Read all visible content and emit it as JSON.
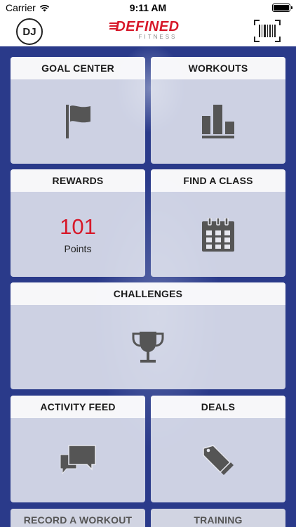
{
  "status_bar": {
    "carrier": "Carrier",
    "time": "9:11 AM"
  },
  "header": {
    "avatar_initials": "DJ",
    "logo_text": "DEFINED",
    "logo_subtext": "FITNESS"
  },
  "tiles": {
    "goal_center": {
      "label": "GOAL CENTER",
      "icon": "flag-icon"
    },
    "workouts": {
      "label": "WORKOUTS",
      "icon": "bar-chart-icon"
    },
    "rewards": {
      "label": "REWARDS",
      "points_value": "101",
      "points_label": "Points"
    },
    "find_a_class": {
      "label": "FIND A CLASS",
      "icon": "calendar-icon"
    },
    "challenges": {
      "label": "CHALLENGES",
      "icon": "trophy-icon"
    },
    "activity_feed": {
      "label": "ACTIVITY FEED",
      "icon": "chat-bubbles-icon"
    },
    "deals": {
      "label": "DEALS",
      "icon": "price-tag-icon"
    },
    "record_a_workout": {
      "label": "RECORD A WORKOUT"
    },
    "training": {
      "label": "TRAINING"
    }
  },
  "colors": {
    "brand_red": "#d7192a",
    "background_blue": "#2a3a8a",
    "icon_gray": "#555555"
  }
}
